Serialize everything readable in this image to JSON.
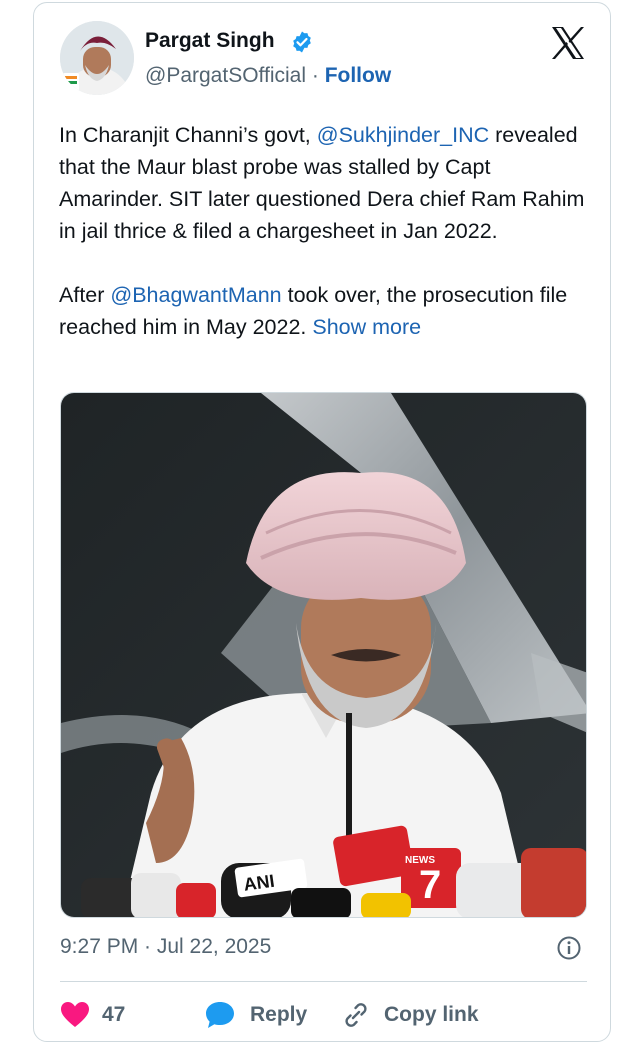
{
  "author": {
    "name": "Pargat Singh",
    "handle": "@PargatSOfficial",
    "separator": "·",
    "follow_label": "Follow"
  },
  "post": {
    "p1_before": "In Charanjit Channi’s govt, ",
    "p1_mention": "@Sukhjinder_INC",
    "p1_after": " revealed that the Maur blast probe was stalled by Capt Amarinder. SIT later questioned Dera chief Ram Rahim in jail thrice & filed a chargesheet in Jan 2022.",
    "p2_before": "After ",
    "p2_mention": "@BhagwantMann",
    "p2_after": " took over, the prosecution file reached him in May 2022. ",
    "show_more": "Show more"
  },
  "media": {
    "mic_labels": [
      "ANI",
      "NEWS"
    ],
    "mic_digit": "7"
  },
  "timestamp": "9:27 PM · Jul 22, 2025",
  "actions": {
    "like_count": "47",
    "reply_label": "Reply",
    "copy_label": "Copy link"
  },
  "colors": {
    "link": "#1d64b2",
    "like": "#f91880",
    "reply": "#1d9bf0",
    "secondary_text": "#536471"
  },
  "icons": [
    "verified-badge-icon",
    "x-logo-icon",
    "info-icon",
    "heart-icon",
    "reply-bubble-icon",
    "link-icon"
  ]
}
